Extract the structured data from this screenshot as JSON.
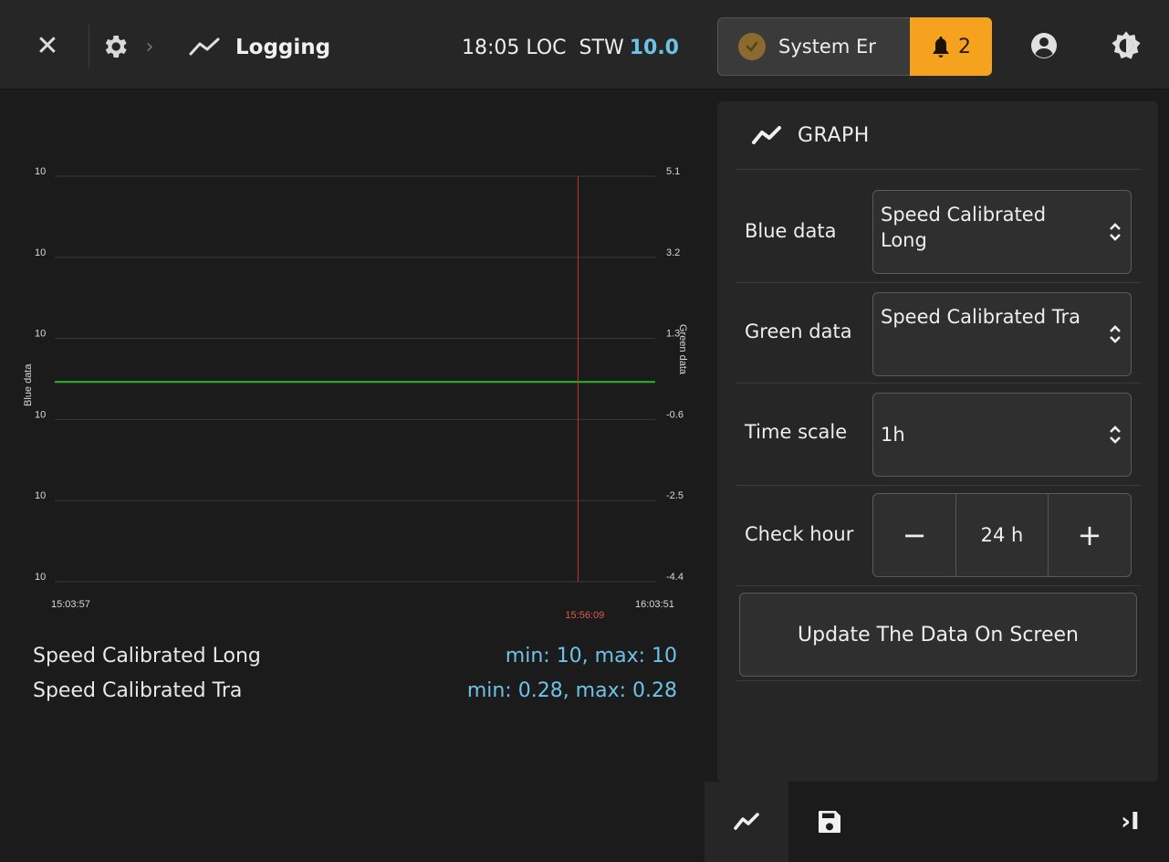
{
  "topbar": {
    "title": "Logging",
    "time": "18:05 LOC",
    "stw_label": "STW",
    "stw_value": "10.0",
    "system_status": "System Er",
    "alarm_count": "2",
    "colors": {
      "accent": "#6cc3e6",
      "alarm": "#f5a21f",
      "status_dot": "#8a6a2e"
    }
  },
  "chart_data": {
    "type": "line",
    "title": "",
    "ylabel_left": "Blue data",
    "ylabel_right": "Green data",
    "y_left_ticks": [
      "10",
      "10",
      "10",
      "10",
      "10",
      "10"
    ],
    "y_right_ticks": [
      "5.1",
      "3.2",
      "1.3",
      "-0.6",
      "-2.5",
      "-4.4"
    ],
    "y_right_range": [
      -4.4,
      5.1
    ],
    "x_ticks": [
      "15:03:57",
      "16:03:51"
    ],
    "cursor_label": "15:56:09",
    "grid": true,
    "series": [
      {
        "name": "Speed Calibrated Long",
        "color": "#3f7fd6",
        "axis": "left",
        "values": [
          10,
          10
        ]
      },
      {
        "name": "Speed Calibrated Tra",
        "color": "#2eb82e",
        "axis": "right",
        "values": [
          0.28,
          0.28
        ]
      }
    ],
    "colors": {
      "grid": "#3a3a3a",
      "cursor": "#c0392b",
      "cursor_label": "#e05a4f"
    }
  },
  "legend": [
    {
      "name": "Speed Calibrated Long",
      "range": "min: 10, max: 10"
    },
    {
      "name": "Speed Calibrated Tra",
      "range": "min: 0.28, max: 0.28"
    }
  ],
  "panel": {
    "title": "GRAPH",
    "blue_label": "Blue data",
    "blue_value": "Speed Calibrated Long",
    "green_label": "Green data",
    "green_value": "Speed Calibrated Tra",
    "timescale_label": "Time scale",
    "timescale_value": "1h",
    "checkhour_label": "Check hour",
    "checkhour_value": "24 h",
    "minus": "−",
    "plus": "+",
    "update_label": "Update The Data On Screen"
  },
  "bottom": {
    "collapse": "›I"
  },
  "icons": [
    "close-icon",
    "gear-icon",
    "chevron-right-icon",
    "trend-icon",
    "status-dot-icon",
    "bell-icon",
    "user-icon",
    "theme-icon",
    "sort-chevrons-icon",
    "save-icon"
  ]
}
